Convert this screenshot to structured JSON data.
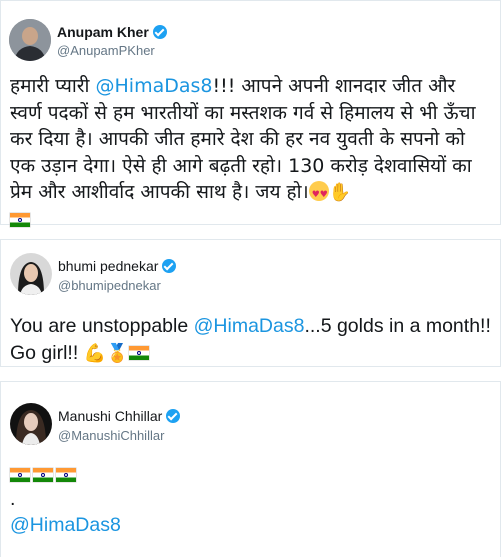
{
  "tweets": [
    {
      "name": "Anupam Kher",
      "handle": "@AnupamPKher",
      "text_pre": "हमारी प्यारी ",
      "mention": "@HimaDas8",
      "text_post": "!!! आपने अपनी शानदार जीत और स्वर्ण पदकों से हम भारतीयों का मस्तशक गर्व से हिमालय से भी ऊँचा कर दिया है। आपकी जीत हमारे देश की हर नव युवती के सपनो को एक उड़ान देगा। ऐसे ही आगे बढ़ती रहो। 130 करोड़ देशवासियों का प्रेम और आशीर्वाद आपकी साथ है। जय हो।",
      "emojis": [
        "heart-eyes",
        "clapping-hands",
        "india-flag"
      ]
    },
    {
      "name": "bhumi pednekar",
      "handle": "@bhumipednekar",
      "text_pre": "You are unstoppable ",
      "mention": "@HimaDas8",
      "text_post": "...5 golds in a month!! Go girl!!",
      "emojis": [
        "flexed-biceps",
        "medal",
        "india-flag"
      ]
    },
    {
      "name": "Manushi Chhillar",
      "handle": "@ManushiChhillar",
      "flags": [
        "india-flag",
        "india-flag",
        "india-flag"
      ],
      "dot": ".",
      "mention": "@HimaDas8"
    }
  ],
  "colors": {
    "link": "#1b95e0",
    "verified": "#1da1f2",
    "handle": "#657786",
    "border": "#e1e8ed"
  }
}
